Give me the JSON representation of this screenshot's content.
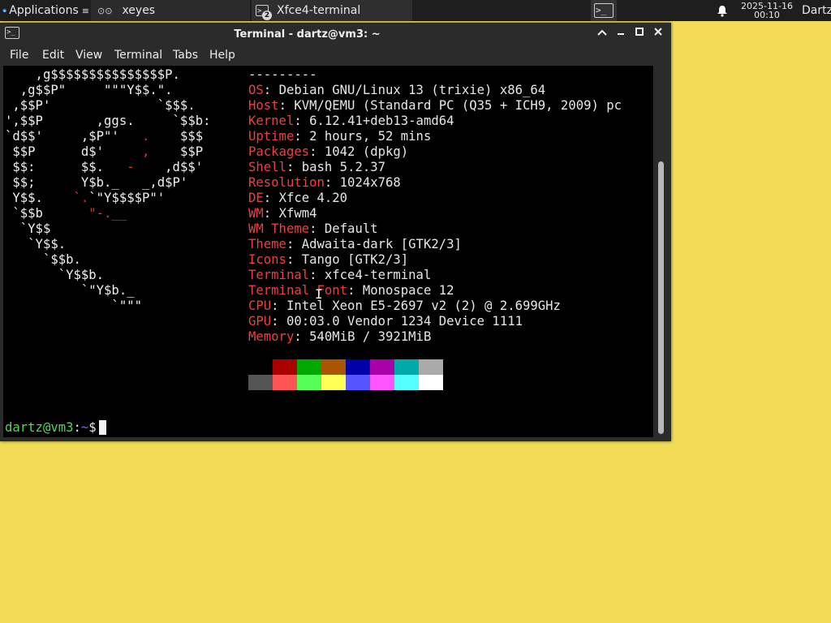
{
  "panel": {
    "applications_label": "Applications",
    "applications_arrow": "≡",
    "tasks": [
      {
        "label": "xeyes",
        "icon": "xeyes-icon"
      },
      {
        "label": "Xfce4-terminal",
        "icon": "terminal-icon",
        "badge": "2"
      }
    ],
    "clock_date": "2025-11-16",
    "clock_time": "00:10",
    "user": "Dartz"
  },
  "window": {
    "title": "Terminal - dartz@vm3: ~",
    "menu": [
      "File",
      "Edit",
      "View",
      "Terminal",
      "Tabs",
      "Help"
    ]
  },
  "terminal": {
    "separator": "---------",
    "info": [
      {
        "key": "OS",
        "value": "Debian GNU/Linux 13 (trixie) x86_64"
      },
      {
        "key": "Host",
        "value": "KVM/QEMU (Standard PC (Q35 + ICH9, 2009) pc"
      },
      {
        "key": "Kernel",
        "value": "6.12.41+deb13-amd64"
      },
      {
        "key": "Uptime",
        "value": "2 hours, 52 mins"
      },
      {
        "key": "Packages",
        "value": "1042 (dpkg)"
      },
      {
        "key": "Shell",
        "value": "bash 5.2.37"
      },
      {
        "key": "Resolution",
        "value": "1024x768"
      },
      {
        "key": "DE",
        "value": "Xfce 4.20"
      },
      {
        "key": "WM",
        "value": "Xfwm4"
      },
      {
        "key": "WM Theme",
        "value": "Default"
      },
      {
        "key": "Theme",
        "value": "Adwaita-dark [GTK2/3]"
      },
      {
        "key": "Icons",
        "value": "Tango [GTK2/3]"
      },
      {
        "key": "Terminal",
        "value": "xfce4-terminal"
      },
      {
        "key": "Terminal Font",
        "value": "Monospace 12"
      },
      {
        "key": "CPU",
        "value": "Intel Xeon E5-2697 v2 (2) @ 2.699GHz"
      },
      {
        "key": "GPU",
        "value": "00:03.0 Vendor 1234 Device 1111"
      },
      {
        "key": "Memory",
        "value": "540MiB / 3921MiB"
      }
    ],
    "palette_row1": [
      "#000000",
      "#aa0000",
      "#00aa00",
      "#aa5500",
      "#0000aa",
      "#aa00aa",
      "#00aaaa",
      "#aaaaaa"
    ],
    "palette_row2": [
      "#555555",
      "#ff5555",
      "#55ff55",
      "#ffff55",
      "#5555ff",
      "#ff55ff",
      "#55ffff",
      "#ffffff"
    ],
    "prompt_user": "dartz@vm3",
    "prompt_sep": ":",
    "prompt_path": "~",
    "prompt_symbol": "$"
  },
  "colors": {
    "desktop": "#f2dc57",
    "info_key": "#ef3f3f",
    "prompt_user": "#4ddc4d",
    "prompt_path": "#6f6fe7"
  }
}
